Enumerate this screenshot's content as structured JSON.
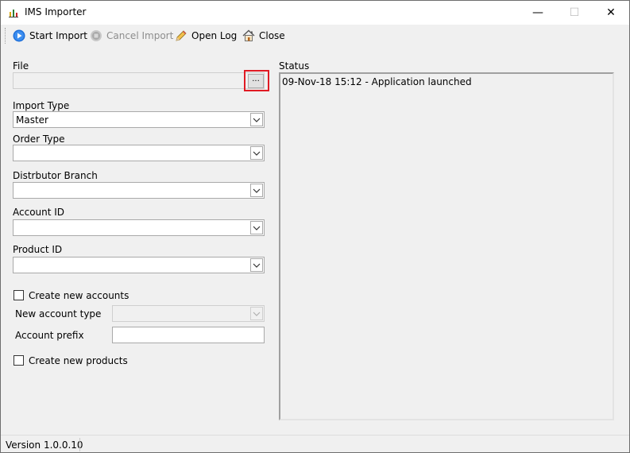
{
  "window": {
    "title": "IMS Importer",
    "minimize": "—",
    "maximize": "☐",
    "close": "✕"
  },
  "toolbar": {
    "start_import": "Start Import",
    "cancel_import": "Cancel Import",
    "open_log": "Open Log",
    "close": "Close"
  },
  "form": {
    "file_label": "File",
    "file_value": "",
    "browse_label": "...",
    "import_type_label": "Import Type",
    "import_type_value": "Master",
    "order_type_label": "Order Type",
    "order_type_value": "",
    "distributor_branch_label": "Distrbutor Branch",
    "distributor_branch_value": "",
    "account_id_label": "Account ID",
    "account_id_value": "",
    "product_id_label": "Product ID",
    "product_id_value": "",
    "create_new_accounts_label": "Create new accounts",
    "create_new_accounts_checked": false,
    "new_account_type_label": "New account type",
    "new_account_type_value": "",
    "account_prefix_label": "Account prefix",
    "account_prefix_value": "",
    "create_new_products_label": "Create new products",
    "create_new_products_checked": false
  },
  "status": {
    "label": "Status",
    "lines": [
      "09-Nov-18 15:12 - Application launched"
    ]
  },
  "statusbar": {
    "version": "Version 1.0.0.10"
  },
  "colors": {
    "highlight": "#e01b24",
    "play_icon": "#1e6fd9"
  }
}
